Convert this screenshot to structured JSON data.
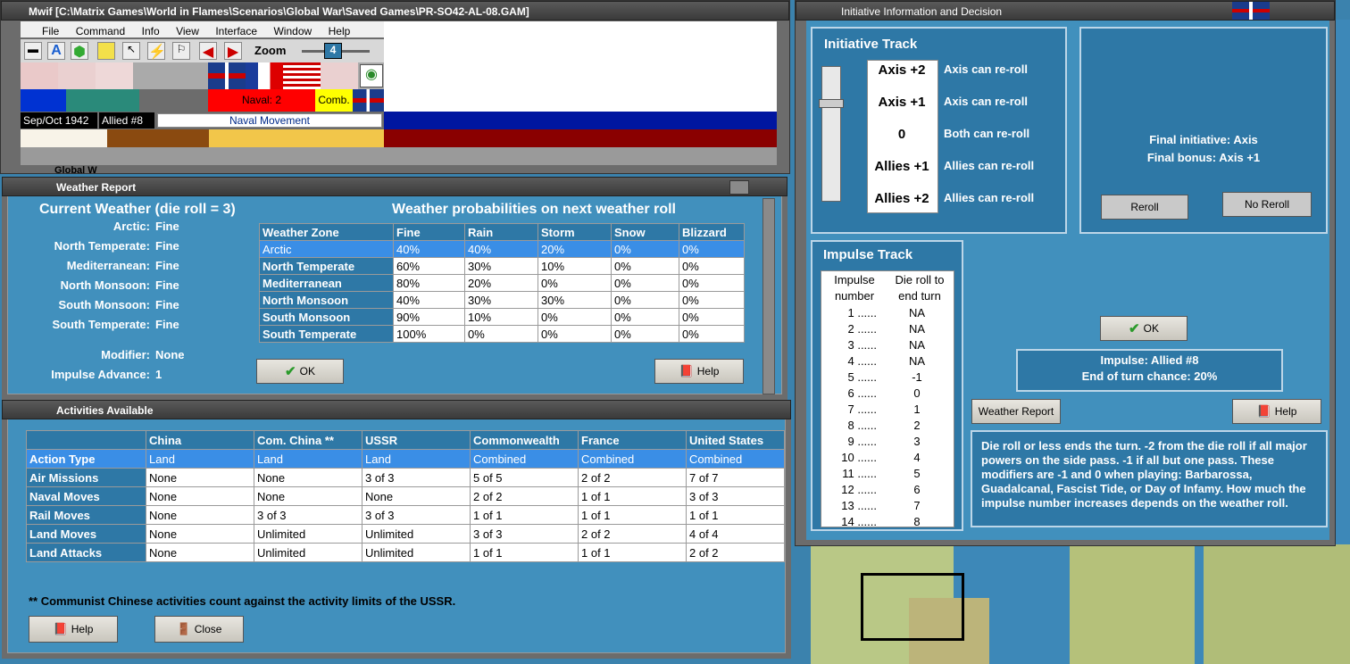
{
  "main_window": {
    "title": "Mwif [C:\\Matrix Games\\World in Flames\\Scenarios\\Global War\\Saved Games\\PR-SO42-AL-08.GAM]",
    "menu": [
      "File",
      "Command",
      "Info",
      "View",
      "Interface",
      "Window",
      "Help"
    ],
    "zoom_label": "Zoom",
    "zoom_value": "4",
    "date": "Sep/Oct 1942",
    "impulse": "Allied #8",
    "phase": "Naval Movement",
    "naval": "Naval: 2",
    "combat": "Comb.",
    "behind_text": "Global W"
  },
  "weather": {
    "title": "Weather Report",
    "current_heading": "Current Weather (die roll = 3)",
    "prob_heading": "Weather probabilities on next weather roll",
    "zones": [
      {
        "label": "Arctic:",
        "value": "Fine"
      },
      {
        "label": "North Temperate:",
        "value": "Fine"
      },
      {
        "label": "Mediterranean:",
        "value": "Fine"
      },
      {
        "label": "North Monsoon:",
        "value": "Fine"
      },
      {
        "label": "South Monsoon:",
        "value": "Fine"
      },
      {
        "label": "South Temperate:",
        "value": "Fine"
      }
    ],
    "modifier_label": "Modifier:",
    "modifier_value": "None",
    "impulse_adv_label": "Impulse Advance:",
    "impulse_adv_value": "1",
    "table_headers": [
      "Weather Zone",
      "Fine",
      "Rain",
      "Storm",
      "Snow",
      "Blizzard"
    ],
    "table_rows": [
      [
        "Arctic",
        "40%",
        "40%",
        "20%",
        "0%",
        "0%"
      ],
      [
        "North Temperate",
        "60%",
        "30%",
        "10%",
        "0%",
        "0%"
      ],
      [
        "Mediterranean",
        "80%",
        "20%",
        "0%",
        "0%",
        "0%"
      ],
      [
        "North Monsoon",
        "40%",
        "30%",
        "30%",
        "0%",
        "0%"
      ],
      [
        "South Monsoon",
        "90%",
        "10%",
        "0%",
        "0%",
        "0%"
      ],
      [
        "South Temperate",
        "100%",
        "0%",
        "0%",
        "0%",
        "0%"
      ]
    ],
    "ok_label": "OK",
    "help_label": "Help"
  },
  "activities": {
    "title": "Activities Available",
    "headers": [
      "",
      "China",
      "Com. China **",
      "USSR",
      "Commonwealth",
      "France",
      "United States"
    ],
    "rows": [
      [
        "Action Type",
        "Land",
        "Land",
        "Land",
        "Combined",
        "Combined",
        "Combined"
      ],
      [
        "Air Missions",
        "None",
        "None",
        "3 of 3",
        "5 of 5",
        "2 of 2",
        "7 of 7"
      ],
      [
        "Naval Moves",
        "None",
        "None",
        "None",
        "2 of 2",
        "1 of 1",
        "3 of 3"
      ],
      [
        "Rail Moves",
        "None",
        "3 of 3",
        "3 of 3",
        "1 of 1",
        "1 of 1",
        "1 of 1"
      ],
      [
        "Land Moves",
        "None",
        "Unlimited",
        "Unlimited",
        "3 of 3",
        "2 of 2",
        "4 of 4"
      ],
      [
        "Land Attacks",
        "None",
        "Unlimited",
        "Unlimited",
        "1 of 1",
        "1 of 1",
        "2 of 2"
      ]
    ],
    "footnote": "** Communist Chinese activities count against the activity limits of the USSR.",
    "help_label": "Help",
    "close_label": "Close"
  },
  "initiative": {
    "title": "Initiative Information and Decision",
    "track_title": "Initiative Track",
    "track": [
      {
        "level": "Axis +2",
        "desc": "Axis can re-roll"
      },
      {
        "level": "Axis +1",
        "desc": "Axis can re-roll"
      },
      {
        "level": "0",
        "desc": "Both can re-roll"
      },
      {
        "level": "Allies +1",
        "desc": "Allies can re-roll"
      },
      {
        "level": "Allies +2",
        "desc": "Allies can re-roll"
      }
    ],
    "final_initiative": "Final initiative: Axis",
    "final_bonus": "Final bonus: Axis +1",
    "reroll_label": "Reroll",
    "noreroll_label": "No Reroll",
    "impulse_track_title": "Impulse Track",
    "impulse_col1": "Impulse number",
    "impulse_col2": "Die roll to end turn",
    "impulse_rows": [
      [
        "1 ......",
        "NA"
      ],
      [
        "2 ......",
        "NA"
      ],
      [
        "3 ......",
        "NA"
      ],
      [
        "4 ......",
        "NA"
      ],
      [
        "5 ......",
        "-1"
      ],
      [
        "6 ......",
        "0"
      ],
      [
        "7 ......",
        "1"
      ],
      [
        "8 ......",
        "2"
      ],
      [
        "9 ......",
        "3"
      ],
      [
        "10 ......",
        "4"
      ],
      [
        "11 ......",
        "5"
      ],
      [
        "12 ......",
        "6"
      ],
      [
        "13 ......",
        "7"
      ],
      [
        "14 ......",
        "8"
      ]
    ],
    "ok_label": "OK",
    "impulse_info": "Impulse: Allied #8",
    "end_chance": "End of turn chance: 20%",
    "weather_report_label": "Weather Report",
    "help_label": "Help",
    "explanation": "Die roll or less ends the turn.  -2 from the die roll if all major powers on the side pass.  -1 if all but one pass.  These modifiers are -1 and 0 when playing: Barbarossa, Guadalcanal, Fascist Tide, or Day of Infamy.  How much the impulse number increases depends on the weather roll."
  }
}
